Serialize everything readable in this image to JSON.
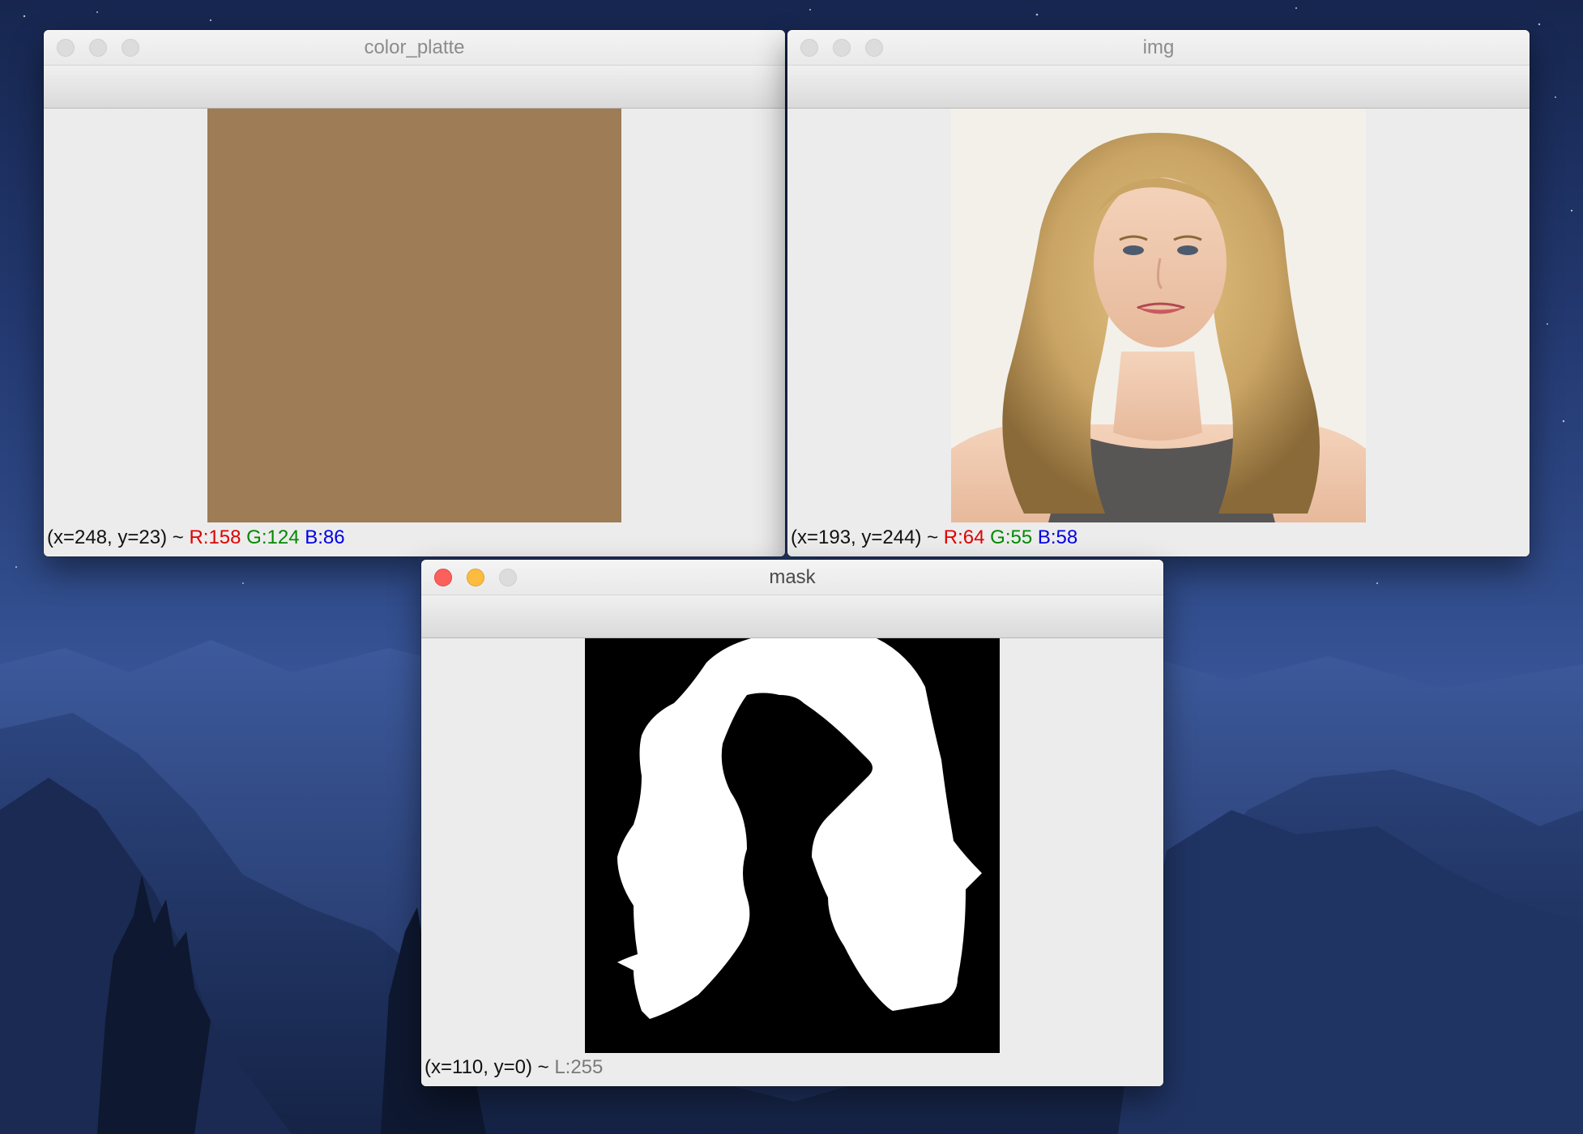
{
  "windows": {
    "color_platte": {
      "title": "color_platte",
      "swatch_color": "#9e7c56",
      "status": {
        "coords": "(x=248, y=23) ~ ",
        "r": "R:158",
        "g": "G:124",
        "b": "B:86"
      }
    },
    "img": {
      "title": "img",
      "status": {
        "coords": "(x=193, y=244) ~ ",
        "r": "R:64",
        "g": "G:55",
        "b": "B:58"
      }
    },
    "mask": {
      "title": "mask",
      "status": {
        "coords": "(x=110, y=0) ~ ",
        "l": "L:255"
      }
    }
  },
  "colors": {
    "hair_blonde": "#c9a464",
    "top_gray": "#585555",
    "skin": "#f0c9ae",
    "photo_bg": "#f3f0ea"
  }
}
